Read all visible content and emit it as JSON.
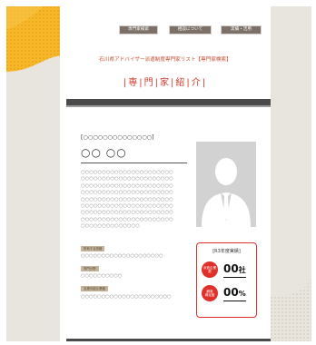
{
  "nav": {
    "buttons": [
      "専門家検索",
      "相談について",
      "実績・活用"
    ]
  },
  "header": {
    "site_title": "石川県アドバイザー派遣制度専門家リスト【専門家検索】",
    "page_heading": "|専|門|家|紹|介|"
  },
  "profile": {
    "organization": "[○○○○○○○○○○○○○○]",
    "name": "○○ ○○",
    "bio_lines": [
      "○○○○○○○○○○○○○○○○○○○○○○",
      "○○○○○○○○○○○○○○○○○○○○○○",
      "○○○○○○○○○○○○○○○○○○○○○○",
      "○○○○○○○○○○○○○○○○○○○○○○",
      "○○○○○○○○○○○○○○○○○○○○○○",
      "○○○○○○○○○○○○○○○○○○○○○○",
      "○○○○○○○○○○○○○○○○○○○○○○",
      "○○○○○○○○○○○○○○○○○○○○○○",
      "○○○○○○○○○○○○○○"
    ]
  },
  "details": [
    {
      "label": "所有する資格",
      "value": "○○○○○○○○○○○○○○○○○○○○"
    },
    {
      "label": "専門分野",
      "value": "○○○○○○○○○○"
    },
    {
      "label": "支援可能な業種",
      "value": "○○○○○○○○○○○○○○○○○○○○○○"
    }
  ],
  "stats": {
    "title": "[R3年度実績]",
    "items": [
      {
        "label_line1": "派遣企業",
        "label_line2": "数",
        "value": "00",
        "unit": "社"
      },
      {
        "label_line1": "顧客",
        "label_line2": "満足度",
        "value": "00",
        "unit": "%"
      }
    ]
  },
  "colors": {
    "accent": "#e0302a",
    "brand_yellow": "#f5b82a",
    "background": "#e8e4de",
    "dark_bar": "#4a4a4a",
    "nav_button": "#7c7068",
    "label_tag": "#c4b49c"
  },
  "icons": {
    "photo": "person-silhouette-icon"
  }
}
